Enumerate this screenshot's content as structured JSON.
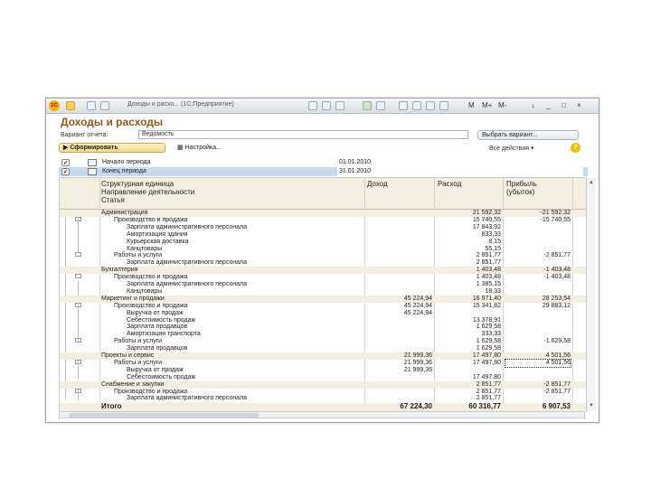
{
  "window": {
    "title": "Доходы и расхо... (1С:Предприятие)",
    "logo_text": "1С",
    "toolbar_text": [
      "M",
      "M+",
      "M-"
    ]
  },
  "page_title": "Доходы и расходы",
  "variant": {
    "label": "Вариант отчета:",
    "value": "Ведомость",
    "choose_button": "Выбрать вариант..."
  },
  "actions": {
    "generate_button": "Сформировать",
    "settings_button": "Настройка...",
    "all_actions": "Все действия ▾",
    "help": "?"
  },
  "periods": [
    {
      "label": "Начало периода",
      "value": "01.01.2010"
    },
    {
      "label": "Конец периода",
      "value": "31.01.2010"
    }
  ],
  "columns": {
    "name": [
      "Структурная единица",
      "Направление деятельности",
      "Статья"
    ],
    "income": "Доход",
    "expense": "Расход",
    "profit": [
      "Прибыль",
      "(убыток)"
    ]
  },
  "rows": [
    {
      "level": 0,
      "name": "Администрация",
      "income": "",
      "expense": "21 592,32",
      "profit": "-21 592,32"
    },
    {
      "level": 1,
      "name": "Производство и продажа",
      "income": "",
      "expense": "15 740,55",
      "profit": "-15 740,55"
    },
    {
      "level": 2,
      "name": "Зарплата административного персонала",
      "income": "",
      "expense": "17 843,92",
      "profit": ""
    },
    {
      "level": 2,
      "name": "Амортизация здания",
      "income": "",
      "expense": "833,33",
      "profit": ""
    },
    {
      "level": 2,
      "name": "Курьерская доставка",
      "income": "",
      "expense": "8,15",
      "profit": ""
    },
    {
      "level": 2,
      "name": "Канцтовары",
      "income": "",
      "expense": "55,15",
      "profit": ""
    },
    {
      "level": 1,
      "name": "Работы и услуги",
      "income": "",
      "expense": "2 851,77",
      "profit": "-2 851,77"
    },
    {
      "level": 2,
      "name": "Зарплата административного персонала",
      "income": "",
      "expense": "2 851,77",
      "profit": ""
    },
    {
      "level": 0,
      "name": "Бухгалтерия",
      "income": "",
      "expense": "1 403,48",
      "profit": "-1 403,48"
    },
    {
      "level": 1,
      "name": "Производство и продажа",
      "income": "",
      "expense": "1 403,48",
      "profit": "-1 403,48"
    },
    {
      "level": 2,
      "name": "Зарплата административного персонала",
      "income": "",
      "expense": "1 385,15",
      "profit": ""
    },
    {
      "level": 2,
      "name": "Канцтовары",
      "income": "",
      "expense": "18,33",
      "profit": ""
    },
    {
      "level": 0,
      "name": "Маркетинг и продажи",
      "income": "45 224,94",
      "expense": "16 971,40",
      "profit": "28 253,54"
    },
    {
      "level": 1,
      "name": "Производство и продажа",
      "income": "45 224,94",
      "expense": "15 341,82",
      "profit": "29 883,12"
    },
    {
      "level": 2,
      "name": "Выручка от продаж",
      "income": "45 224,94",
      "expense": "",
      "profit": ""
    },
    {
      "level": 2,
      "name": "Себестоимость продаж",
      "income": "",
      "expense": "13 378,91",
      "profit": ""
    },
    {
      "level": 2,
      "name": "Зарплата продавцов",
      "income": "",
      "expense": "1 629,58",
      "profit": ""
    },
    {
      "level": 2,
      "name": "Амортизация транспорта",
      "income": "",
      "expense": "333,33",
      "profit": ""
    },
    {
      "level": 1,
      "name": "Работы и услуги",
      "income": "",
      "expense": "1 629,58",
      "profit": "-1 629,58"
    },
    {
      "level": 2,
      "name": "Зарплата продавцов",
      "income": "",
      "expense": "1 629,58",
      "profit": ""
    },
    {
      "level": 0,
      "name": "Проекты и сервис",
      "income": "21 999,36",
      "expense": "17 497,80",
      "profit": "4 501,56"
    },
    {
      "level": 1,
      "name": "Работы и услуги",
      "income": "21 999,36",
      "expense": "17 497,80",
      "profit": "4 501,56"
    },
    {
      "level": 2,
      "name": "Выручка от продаж",
      "income": "21 999,36",
      "expense": "",
      "profit": ""
    },
    {
      "level": 2,
      "name": "Себестоимость продаж",
      "income": "",
      "expense": "17 497,80",
      "profit": ""
    },
    {
      "level": 0,
      "name": "Снабжение и закупки",
      "income": "",
      "expense": "2 851,77",
      "profit": "-2 851,77"
    },
    {
      "level": 1,
      "name": "Производство и продажа",
      "income": "",
      "expense": "2 851,77",
      "profit": "-2 851,77"
    },
    {
      "level": 2,
      "name": "Зарплата административного персонала",
      "income": "",
      "expense": "2 851,77",
      "profit": ""
    }
  ],
  "total": {
    "name": "Итого",
    "income": "67 224,30",
    "expense": "60 316,77",
    "profit": "6 907,53"
  }
}
